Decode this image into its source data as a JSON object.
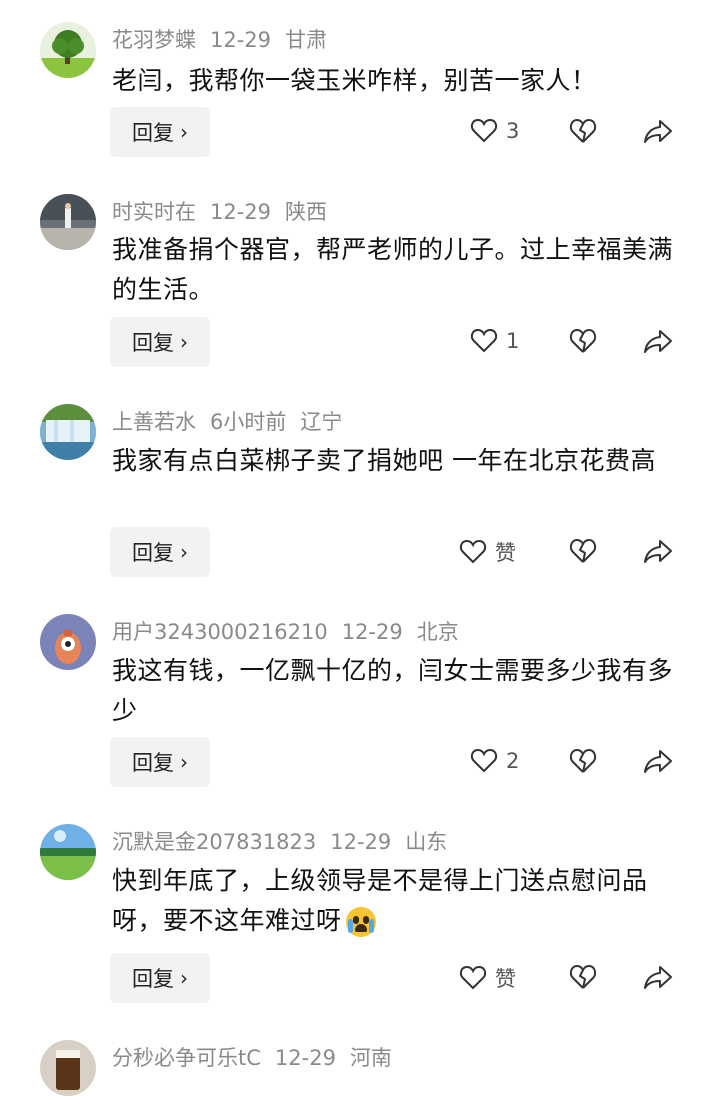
{
  "comments": [
    {
      "user": "花羽梦蝶",
      "date": "12-29",
      "location": "甘肃",
      "text": "老闫，我帮你一袋玉米咋样，别苦一家人！",
      "likes": "3",
      "reply": "回复"
    },
    {
      "user": "时实时在",
      "date": "12-29",
      "location": "陕西",
      "text": "我准备捐个器官，帮严老师的儿子。过上幸福美满的生活。",
      "likes": "1",
      "reply": "回复"
    },
    {
      "user": "上善若水",
      "date": "6小时前",
      "location": "辽宁",
      "text": "我家有点白菜梆子卖了捐她吧 一年在北京花费高",
      "likes": "赞",
      "reply": "回复"
    },
    {
      "user": "用户3243000216210",
      "date": "12-29",
      "location": "北京",
      "text": "我这有钱，一亿飘十亿的，闫女士需要多少我有多少",
      "likes": "2",
      "reply": "回复"
    },
    {
      "user": "沉默是金207831823",
      "date": "12-29",
      "location": "山东",
      "text": "快到年底了，上级领导是不是得上门送点慰问品呀，要不这年难过呀",
      "likes": "赞",
      "reply": "回复"
    },
    {
      "user": "分秒必争可乐tC",
      "date": "12-29",
      "location": "河南"
    }
  ],
  "icons": {
    "like": "heart-outline-icon",
    "dislike": "broken-heart-icon",
    "share": "share-arrow-icon",
    "crying_emoji": "crying-face-emoji"
  },
  "colors": {
    "meta_text": "#8a8a8a",
    "reply_bg": "#f2f2f2"
  }
}
